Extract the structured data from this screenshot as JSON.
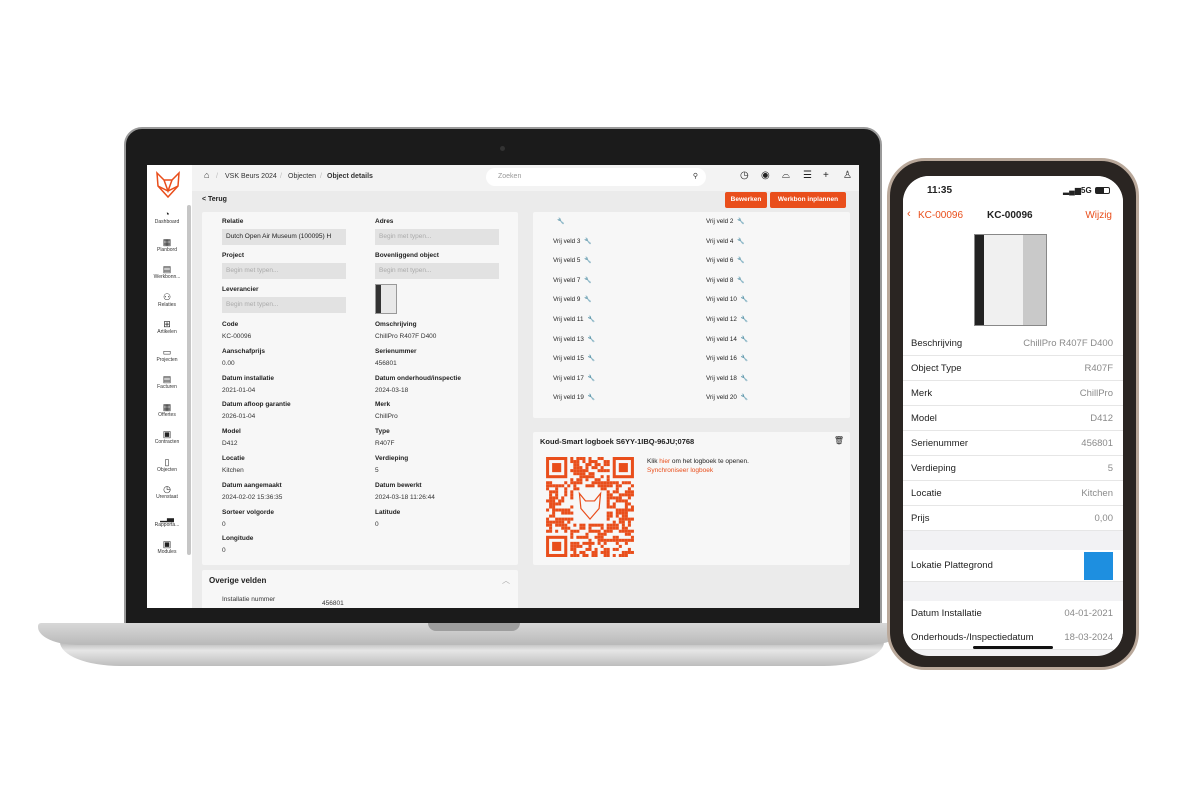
{
  "laptop": {
    "sidebar": {
      "items": [
        {
          "label": "Dashboard",
          "icon": "gauge-icon"
        },
        {
          "label": "Planbord",
          "icon": "calendar-icon"
        },
        {
          "label": "Werkbonn...",
          "icon": "document-icon"
        },
        {
          "label": "Relaties",
          "icon": "users-icon"
        },
        {
          "label": "Artikelen",
          "icon": "boxes-icon"
        },
        {
          "label": "Projecten",
          "icon": "briefcase-icon"
        },
        {
          "label": "Facturen",
          "icon": "invoice-icon"
        },
        {
          "label": "Offertes",
          "icon": "calculator-icon"
        },
        {
          "label": "Contracten",
          "icon": "contract-icon"
        },
        {
          "label": "Objecten",
          "icon": "fridge-icon"
        },
        {
          "label": "Urenstaat",
          "icon": "clock-icon"
        },
        {
          "label": "Rapporta...",
          "icon": "chart-icon"
        },
        {
          "label": "Modules",
          "icon": "module-icon"
        }
      ]
    },
    "breadcrumb": [
      "VSK Beurs 2024",
      "Objecten",
      "Object details"
    ],
    "search_placeholder": "Zoeken",
    "back": "< Terug",
    "buttons": {
      "edit": "Bewerken",
      "plan": "Werkbon inplannen"
    },
    "form": {
      "relatie": {
        "label": "Relatie",
        "value": "Dutch Open Air Museum (100095) H"
      },
      "adres": {
        "label": "Adres",
        "placeholder": "Begin met typen..."
      },
      "project": {
        "label": "Project",
        "placeholder": "Begin met typen..."
      },
      "bovenliggend": {
        "label": "Bovenliggend object",
        "placeholder": "Begin met typen..."
      },
      "leverancier": {
        "label": "Leverancier",
        "placeholder": "Begin met typen..."
      },
      "fields": [
        [
          {
            "label": "Code",
            "value": "KC-00096"
          },
          {
            "label": "Omschrijving",
            "value": "ChillPro R407F D400"
          }
        ],
        [
          {
            "label": "Aanschafprijs",
            "value": "0.00"
          },
          {
            "label": "Serienummer",
            "value": "456801"
          }
        ],
        [
          {
            "label": "Datum installatie",
            "value": "2021-01-04"
          },
          {
            "label": "Datum onderhoud/inspectie",
            "value": "2024-03-18"
          }
        ],
        [
          {
            "label": "Datum afloop garantie",
            "value": "2026-01-04"
          },
          {
            "label": "Merk",
            "value": "ChillPro"
          }
        ],
        [
          {
            "label": "Model",
            "value": "D412"
          },
          {
            "label": "Type",
            "value": "R407F"
          }
        ],
        [
          {
            "label": "Locatie",
            "value": "Kitchen"
          },
          {
            "label": "Verdieping",
            "value": "5"
          }
        ],
        [
          {
            "label": "Datum aangemaakt",
            "value": "2024-02-02 15:36:35"
          },
          {
            "label": "Datum bewerkt",
            "value": "2024-03-18 11:26:44"
          }
        ],
        [
          {
            "label": "Sorteer volgorde",
            "value": "0"
          },
          {
            "label": "Latitude",
            "value": "0"
          }
        ],
        [
          {
            "label": "Longitude",
            "value": "0"
          },
          null
        ]
      ]
    },
    "overige": {
      "title": "Overige velden",
      "label": "Installatie nummer",
      "value": "456801"
    },
    "vrije_velden": [
      "",
      "Vrij veld 2",
      "Vrij veld 3",
      "Vrij veld 4",
      "Vrij veld 5",
      "Vrij veld 6",
      "Vrij veld 7",
      "Vrij veld 8",
      "Vrij veld 9",
      "Vrij veld 10",
      "Vrij veld 11",
      "Vrij veld 12",
      "Vrij veld 13",
      "Vrij veld 14",
      "Vrij veld 15",
      "Vrij veld 16",
      "Vrij veld 17",
      "Vrij veld 18",
      "Vrij veld 19",
      "Vrij veld 20"
    ],
    "logbook": {
      "title": "Koud-Smart logboek S6YY-1IBQ-96JU;0768",
      "text_pre": "Klik ",
      "link": "hier",
      "text_post": " om het logboek te openen.",
      "sync": "Synchroniseer logboek"
    },
    "accent": "#e94e1b"
  },
  "phone": {
    "time": "11:35",
    "network": "5G",
    "back": "KC-00096",
    "title": "KC-00096",
    "edit": "Wijzig",
    "rows": [
      {
        "k": "Beschrijving",
        "v": "ChillPro R407F D400"
      },
      {
        "k": "Object Type",
        "v": "R407F"
      },
      {
        "k": "Merk",
        "v": "ChillPro"
      },
      {
        "k": "Model",
        "v": "D412"
      },
      {
        "k": "Serienummer",
        "v": "456801"
      },
      {
        "k": "Verdieping",
        "v": "5"
      },
      {
        "k": "Locatie",
        "v": "Kitchen"
      },
      {
        "k": "Prijs",
        "v": "0,00"
      }
    ],
    "plattegrond": "Lokatie Plattegrond",
    "rows2": [
      {
        "k": "Datum Installatie",
        "v": "04-01-2021"
      },
      {
        "k": "Onderhouds-/Inspectiedatum",
        "v": "18-03-2024"
      }
    ]
  }
}
